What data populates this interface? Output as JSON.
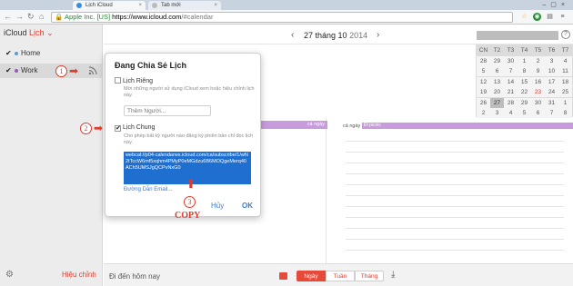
{
  "browser": {
    "tabs": [
      {
        "label": "Lịch iCloud"
      },
      {
        "label": "Tab mới"
      }
    ],
    "ev_label": "Apple Inc. [US]",
    "url_host": "https://www.icloud.com",
    "url_path": "/#calendar"
  },
  "app": {
    "name": "iCloud",
    "section": "Lịch",
    "calendars": [
      {
        "name": "Home",
        "color": "#5b9bd5"
      },
      {
        "name": "Work",
        "color": "#9b59b6"
      }
    ],
    "edit_label": "Hiệu chỉnh"
  },
  "header": {
    "date": "27 tháng 10",
    "year": "2014",
    "help": "?"
  },
  "minical": {
    "days_header": [
      "CN",
      "T2",
      "T3",
      "T4",
      "T5",
      "T6",
      "T7"
    ],
    "weeks": [
      [
        "28",
        "29",
        "30",
        "1",
        "2",
        "3",
        "4"
      ],
      [
        "5",
        "6",
        "7",
        "8",
        "9",
        "10",
        "11"
      ],
      [
        "12",
        "13",
        "14",
        "15",
        "16",
        "17",
        "18"
      ],
      [
        "19",
        "20",
        "21",
        "22",
        "23",
        "24",
        "25"
      ],
      [
        "26",
        "27",
        "28",
        "29",
        "30",
        "31",
        "1"
      ],
      [
        "2",
        "3",
        "4",
        "5",
        "6",
        "7",
        "8"
      ]
    ],
    "today": "27"
  },
  "dayview": {
    "allday_label": "cả ngày",
    "event_title": "Đi picnic",
    "side_event_label": "cả ngày"
  },
  "bottom": {
    "goto_today": "Đi đến hôm nay",
    "views": [
      "Ngày",
      "Tuần",
      "Tháng"
    ],
    "active_view": "Ngày"
  },
  "popover": {
    "title": "Đang Chia Sẻ Lịch",
    "private_label": "Lịch Riêng",
    "private_desc": "Mời những người sử dụng iCloud xem hoặc hiệu chỉnh lịch này.",
    "invite_placeholder": "Thêm Người...",
    "public_label": "Lịch Chung",
    "public_desc": "Cho phép bất kỳ người nào đăng ký phiên bản chỉ đọc lịch này.",
    "public_url": "webcal://p04-calendarws.icloud.com/ca/subscribe/1/wN2tTccW6mf5xqhm4PMyP0eMGdzu6B6MOQgeMerq40ACh5UMSJgQCPvNxG0",
    "email_link": "Đường Dẫn Email...",
    "cancel": "Hủy",
    "ok": "OK"
  },
  "annotations": {
    "step1": "1",
    "step2": "2",
    "step3": "3",
    "copy": "COPY"
  }
}
